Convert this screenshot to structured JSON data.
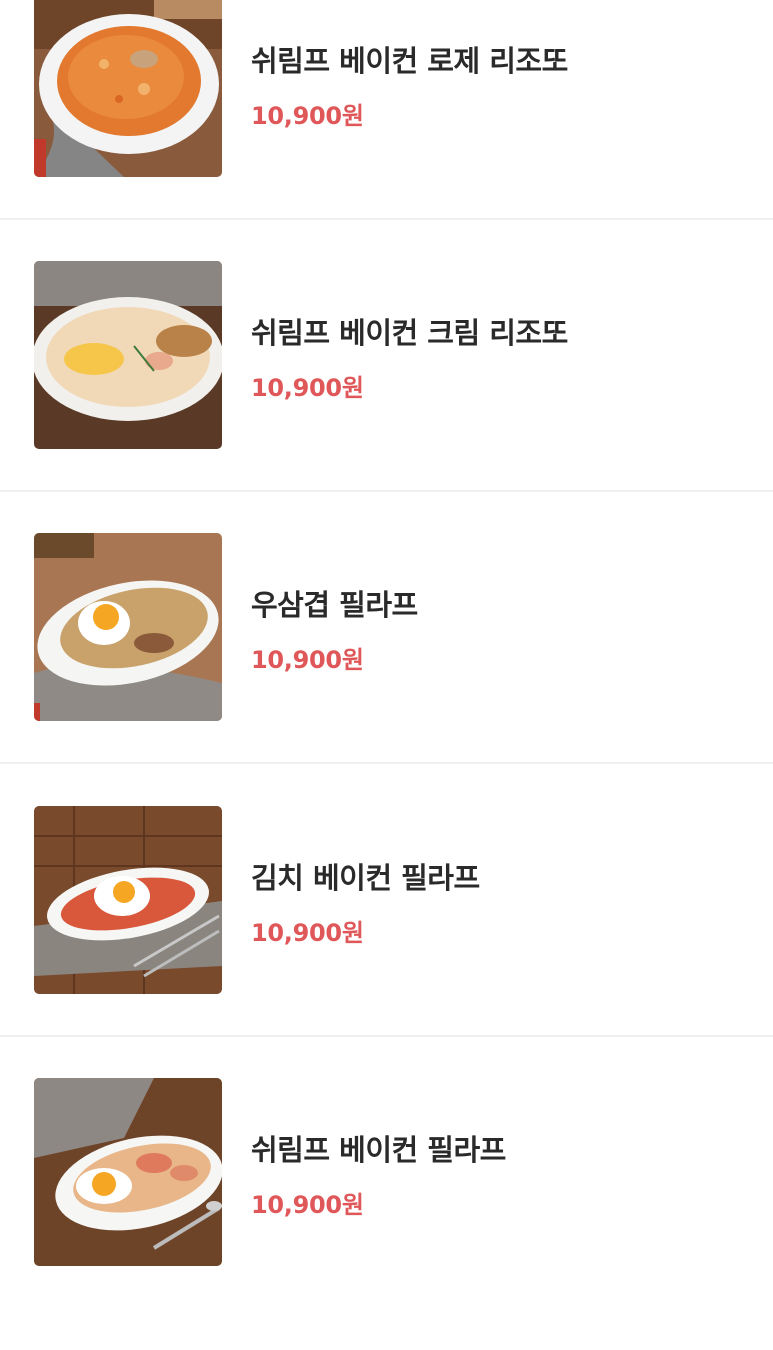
{
  "menu": {
    "items": [
      {
        "name": "쉬림프 베이컨 로제 리조또",
        "price": "10,900원",
        "image": "rose-risotto-photo"
      },
      {
        "name": "쉬림프 베이컨 크림 리조또",
        "price": "10,900원",
        "image": "cream-risotto-photo"
      },
      {
        "name": "우삼겹 필라프",
        "price": "10,900원",
        "image": "beef-pilaf-photo"
      },
      {
        "name": "김치 베이컨 필라프",
        "price": "10,900원",
        "image": "kimchi-pilaf-photo"
      },
      {
        "name": "쉬림프 베이컨 필라프",
        "price": "10,900원",
        "image": "shrimp-pilaf-photo"
      }
    ]
  },
  "colors": {
    "price": "#e0575a",
    "name": "#2a2a2a",
    "divider": "#efefef",
    "background": "#ffffff"
  }
}
